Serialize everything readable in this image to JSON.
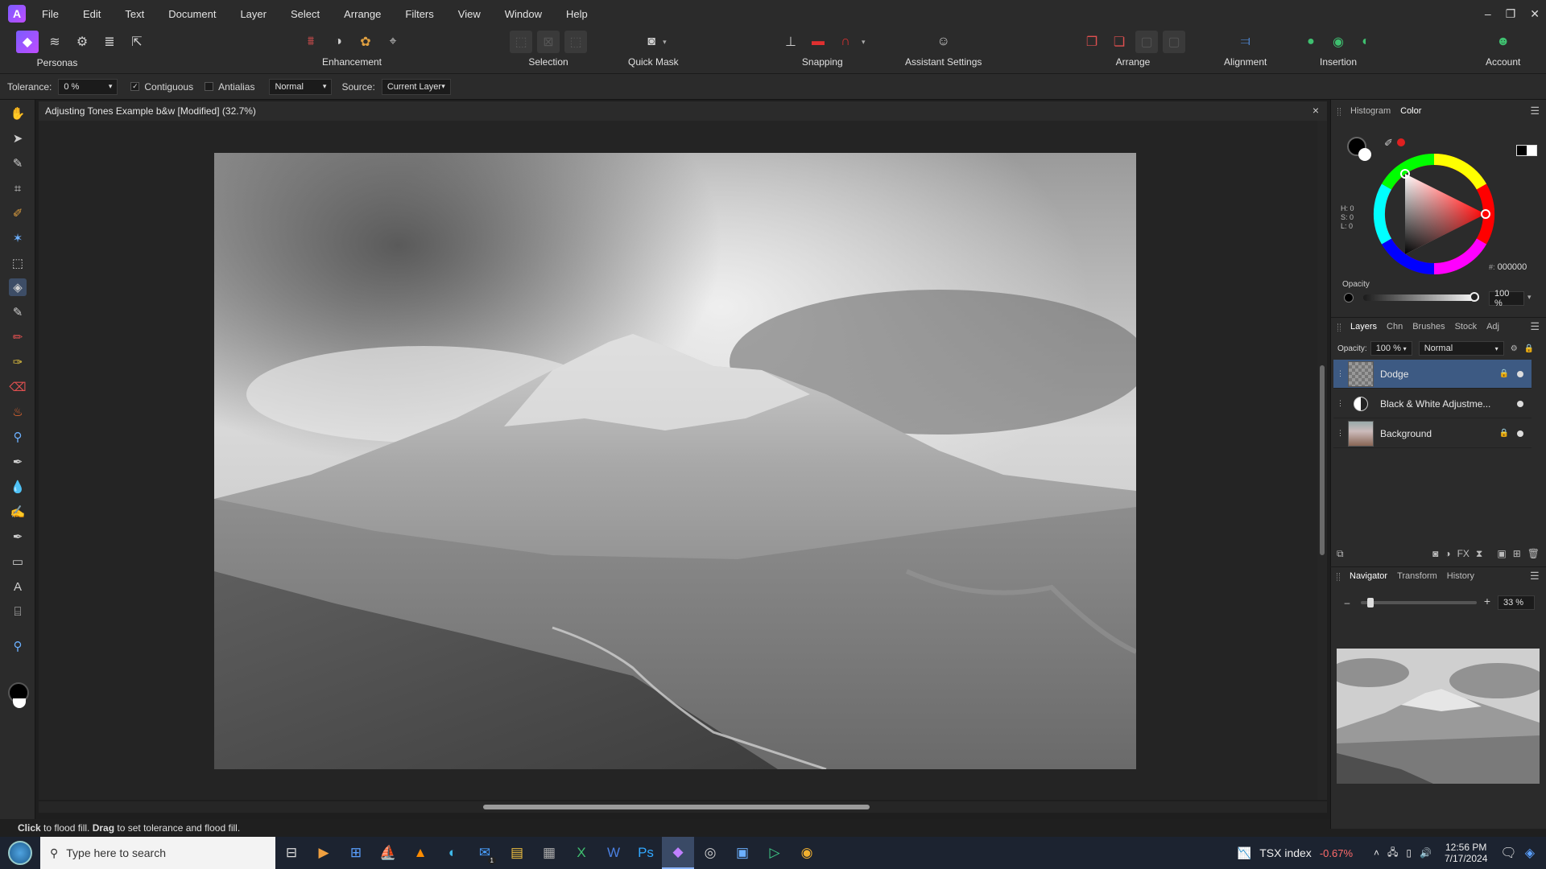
{
  "menubar": {
    "items": [
      "File",
      "Edit",
      "Text",
      "Document",
      "Layer",
      "Select",
      "Arrange",
      "Filters",
      "View",
      "Window",
      "Help"
    ]
  },
  "toolbar": {
    "personas_label": "Personas",
    "enhancement_label": "Enhancement",
    "selection_label": "Selection",
    "quickmask_label": "Quick Mask",
    "snapping_label": "Snapping",
    "assistant_label": "Assistant Settings",
    "arrange_label": "Arrange",
    "alignment_label": "Alignment",
    "insertion_label": "Insertion",
    "account_label": "Account"
  },
  "context": {
    "tolerance_label": "Tolerance:",
    "tolerance_value": "0 %",
    "contiguous_label": "Contiguous",
    "contiguous_checked": true,
    "antialias_label": "Antialias",
    "antialias_checked": false,
    "blend_mode": "Normal",
    "source_label": "Source:",
    "source_value": "Current Layer"
  },
  "document": {
    "title": "Adjusting Tones Example b&w [Modified] (32.7%)",
    "close_icon": "×"
  },
  "color_panel": {
    "tabs": [
      "Histogram",
      "Color"
    ],
    "active_tab": "Color",
    "h": "H: 0",
    "s": "S: 0",
    "l": "L: 0",
    "hex_label": "#:",
    "hex": "000000",
    "opacity_label": "Opacity",
    "opacity_value": "100 %",
    "opacity_fraction": 1.0
  },
  "layers_panel": {
    "tabs": [
      "Layers",
      "Chn",
      "Brushes",
      "Stock",
      "Adj"
    ],
    "active_tab": "Layers",
    "opacity_label": "Opacity:",
    "opacity_value": "100 %",
    "blend_mode": "Normal",
    "layers": [
      {
        "name": "Dodge",
        "selected": true
      },
      {
        "name": "Black & White Adjustme...",
        "selected": false
      },
      {
        "name": "Background",
        "selected": false
      }
    ]
  },
  "navigator_panel": {
    "tabs": [
      "Navigator",
      "Transform",
      "History"
    ],
    "active_tab": "Navigator",
    "zoom_value": "33 %",
    "zoom_fraction": 0.06
  },
  "statusbar": {
    "click_word": "Click",
    "click_text": " to flood fill. ",
    "drag_word": "Drag",
    "drag_text": " to set tolerance and flood fill."
  },
  "taskbar": {
    "search_placeholder": "Type here to search",
    "stock_name": "TSX index",
    "stock_change": "-0.67%",
    "time": "12:56 PM",
    "date": "7/17/2024",
    "mail_badge": "1"
  },
  "colors": {
    "accent_selection": "#3d5a83",
    "stock_negative": "#ff6b6b",
    "affinity_brand": "#9a5cff"
  }
}
